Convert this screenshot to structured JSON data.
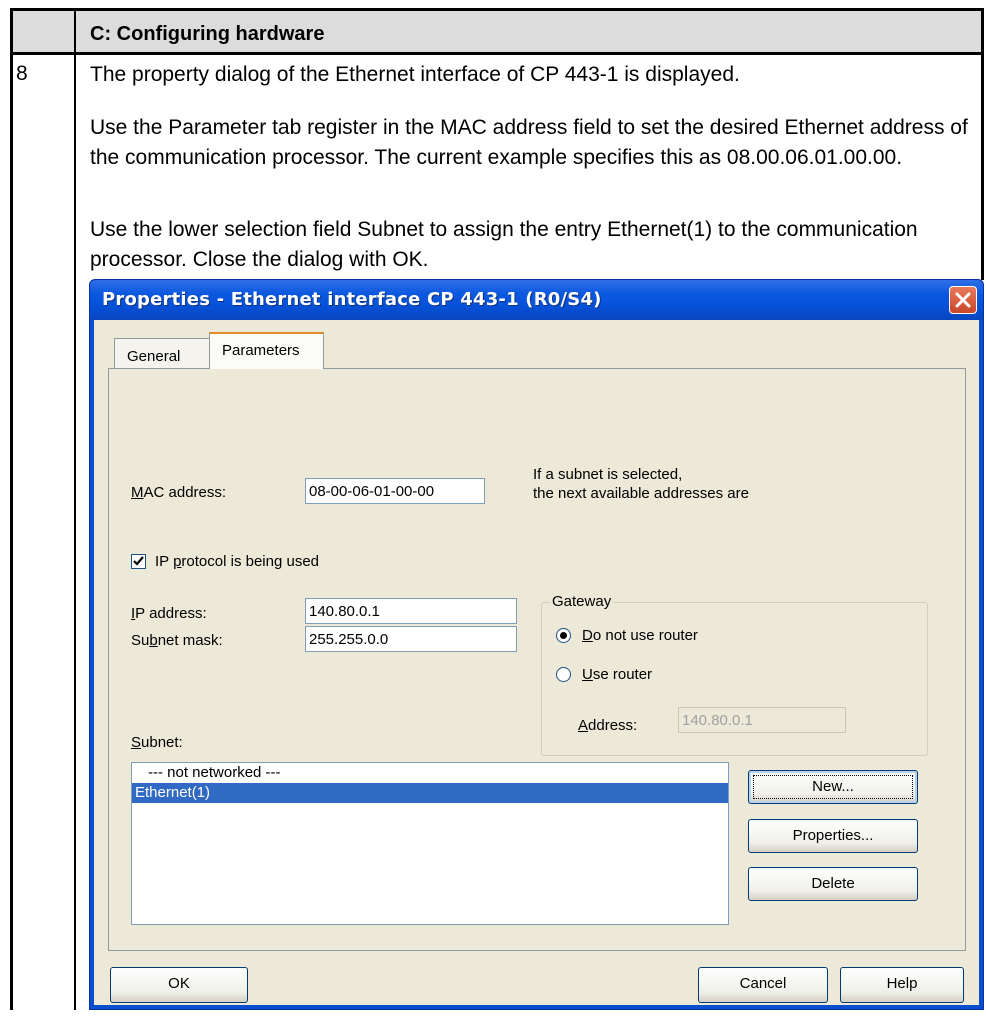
{
  "document": {
    "section_title": "C: Configuring hardware",
    "step_number": "8",
    "paragraphs": [
      "The property dialog of the Ethernet interface of CP 443-1 is displayed.",
      "Use the Parameter tab register in the MAC address field to set the desired Ethernet address of the communication processor. The current example specifies this as 08.00.06.01.00.00.",
      "Use the lower selection field Subnet to assign the entry Ethernet(1) to the communication processor. Close the dialog with OK."
    ]
  },
  "dialog": {
    "title": "Properties - Ethernet interface  CP 443-1 (R0/S4)",
    "tabs": [
      "General",
      "Parameters"
    ],
    "active_tab": "Parameters",
    "mac_label": "MAC address:",
    "mac_value": "08-00-06-01-00-00",
    "mac_hint_line1": "If a subnet is selected,",
    "mac_hint_line2": "the next available addresses are",
    "ip_protocol_label": "IP protocol is being used",
    "ip_protocol_checked": true,
    "ip_label": "IP address:",
    "ip_value": "140.80.0.1",
    "mask_label": "Subnet mask:",
    "mask_value": "255.255.0.0",
    "gateway": {
      "legend": "Gateway",
      "option_no_router": "Do not use router",
      "option_use_router": "Use router",
      "selected": "Do not use router",
      "address_label": "Address:",
      "address_value": "140.80.0.1"
    },
    "subnet_label": "Subnet:",
    "subnet_items": [
      "--- not networked ---",
      "Ethernet(1)"
    ],
    "subnet_selected": "Ethernet(1)",
    "buttons": {
      "new": "New...",
      "properties": "Properties...",
      "delete": "Delete",
      "ok": "OK",
      "cancel": "Cancel",
      "help": "Help"
    }
  },
  "colors": {
    "title_bar": "#0b58e0",
    "selection": "#316ac5",
    "dialog_face": "#ece9d8",
    "header_fill": "#dcdcdc"
  }
}
